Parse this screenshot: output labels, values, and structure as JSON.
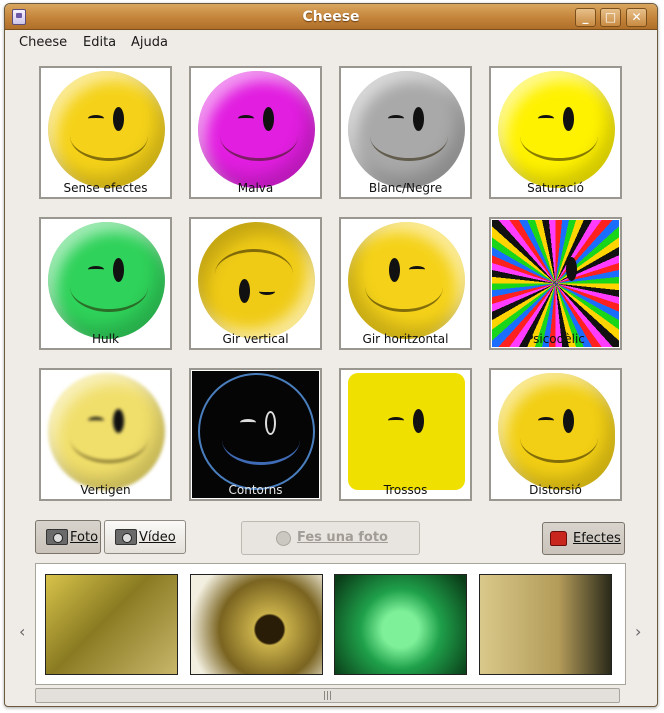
{
  "window": {
    "title": "Cheese"
  },
  "menu": [
    "Cheese",
    "Edita",
    "Ajuda"
  ],
  "effects": [
    {
      "label": "Sense efectes",
      "color": "#f5d219"
    },
    {
      "label": "Malva",
      "color": "#e21ee0"
    },
    {
      "label": "Blanc/Negre",
      "color": "#a9a9a9"
    },
    {
      "label": "Saturació",
      "color": "#fff200"
    },
    {
      "label": "Hulk",
      "color": "#2fd25a"
    },
    {
      "label": "Gir vertical",
      "color": "#f0cb16"
    },
    {
      "label": "Gir horitzontal",
      "color": "#f5d219"
    },
    {
      "label": "Psicodèlic",
      "color": "#ff2a2a"
    },
    {
      "label": "Vertigen",
      "color": "#f1df6b"
    },
    {
      "label": "Contorns",
      "color": "#050505"
    },
    {
      "label": "Trossos",
      "color": "#f0e000"
    },
    {
      "label": "Distorsió",
      "color": "#f2cf14"
    }
  ],
  "buttons": {
    "photo": "Foto",
    "video": "Vídeo",
    "take_photo": "Fes una foto",
    "effects": "Efectes"
  },
  "gallery": {
    "thumbnails": [
      {
        "name": "thumb-1",
        "bg": "#a89b2c"
      },
      {
        "name": "thumb-2",
        "bg": "#6c5a1a"
      },
      {
        "name": "thumb-3",
        "bg": "#1fa04a"
      },
      {
        "name": "thumb-4",
        "bg": "#c9b577"
      }
    ]
  },
  "icons": {
    "window_controls": [
      "minimize-icon",
      "maximize-icon",
      "close-icon"
    ],
    "scroll_left": "‹",
    "scroll_right": "›"
  }
}
